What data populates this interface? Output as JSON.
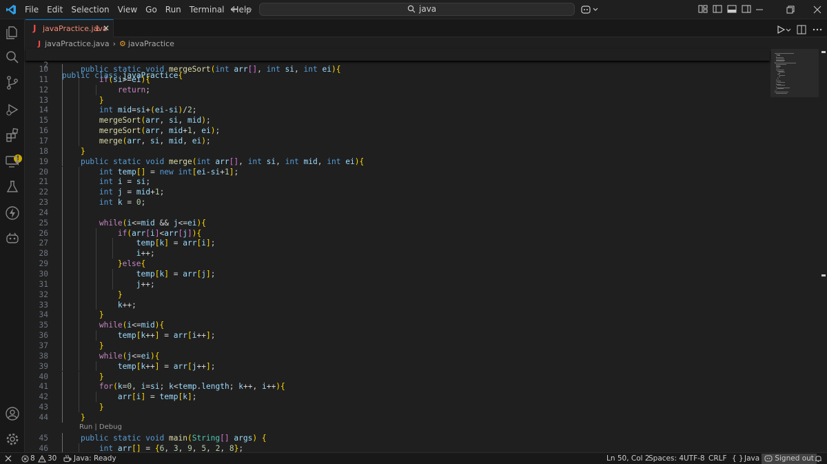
{
  "menus": [
    "File",
    "Edit",
    "Selection",
    "View",
    "Go",
    "Run",
    "Terminal",
    "Help"
  ],
  "search": {
    "text": "java"
  },
  "tab": {
    "icon_letter": "J",
    "name": "javaPractice.java",
    "problems": "1"
  },
  "breadcrumb": {
    "icon_letter": "J",
    "file": "javaPractice.java",
    "symbol": "javaPractice"
  },
  "sticky": {
    "num": "2",
    "code": "public class javaPractice{"
  },
  "codelens": {
    "text": "Run | Debug"
  },
  "lines": [
    {
      "num": "10",
      "code": "    public static void mergeSort(int arr[], int si, int ei){"
    },
    {
      "num": "11",
      "code": "        if(si>=ei){"
    },
    {
      "num": "12",
      "code": "            return;"
    },
    {
      "num": "13",
      "code": "        }"
    },
    {
      "num": "14",
      "code": "        int mid=si+(ei-si)/2;"
    },
    {
      "num": "15",
      "code": "        mergeSort(arr, si, mid);"
    },
    {
      "num": "16",
      "code": "        mergeSort(arr, mid+1, ei);"
    },
    {
      "num": "17",
      "code": "        merge(arr, si, mid, ei);"
    },
    {
      "num": "18",
      "code": "    }"
    },
    {
      "num": "19",
      "code": "    public static void merge(int arr[], int si, int mid, int ei){"
    },
    {
      "num": "20",
      "code": "        int temp[] = new int[ei-si+1];"
    },
    {
      "num": "21",
      "code": "        int i = si;"
    },
    {
      "num": "22",
      "code": "        int j = mid+1;"
    },
    {
      "num": "23",
      "code": "        int k = 0;"
    },
    {
      "num": "24",
      "code": ""
    },
    {
      "num": "25",
      "code": "        while(i<=mid && j<=ei){"
    },
    {
      "num": "26",
      "code": "            if(arr[i]<arr[j]){"
    },
    {
      "num": "27",
      "code": "                temp[k] = arr[i];"
    },
    {
      "num": "28",
      "code": "                i++;"
    },
    {
      "num": "29",
      "code": "            }else{"
    },
    {
      "num": "30",
      "code": "                temp[k] = arr[j];"
    },
    {
      "num": "31",
      "code": "                j++;"
    },
    {
      "num": "32",
      "code": "            }"
    },
    {
      "num": "33",
      "code": "            k++;"
    },
    {
      "num": "34",
      "code": "        }"
    },
    {
      "num": "35",
      "code": "        while(i<=mid){"
    },
    {
      "num": "36",
      "code": "            temp[k++] = arr[i++];"
    },
    {
      "num": "37",
      "code": "        }"
    },
    {
      "num": "38",
      "code": "        while(j<=ei){"
    },
    {
      "num": "39",
      "code": "            temp[k++] = arr[j++];"
    },
    {
      "num": "40",
      "code": "        }"
    },
    {
      "num": "41",
      "code": "        for(k=0, i=si; k<temp.length; k++, i++){"
    },
    {
      "num": "42",
      "code": "            arr[i] = temp[k];"
    },
    {
      "num": "43",
      "code": "        }"
    },
    {
      "num": "44",
      "code": "    }"
    },
    {
      "num": "45",
      "code": "    public static void main(String[] args) {"
    },
    {
      "num": "46",
      "code": "        int arr[] = {6, 3, 9, 5, 2, 8};"
    }
  ],
  "status": {
    "errors": "8",
    "warnings": "30",
    "java": "Java: Ready",
    "position": "Ln 50, Col 2",
    "spaces": "Spaces: 4",
    "encoding": "UTF-8",
    "eol": "CRLF",
    "language": "Java",
    "account": "Signed out"
  },
  "colors": {
    "accent": "#0078d4",
    "error": "#f14c4c",
    "warning": "#cca700"
  }
}
